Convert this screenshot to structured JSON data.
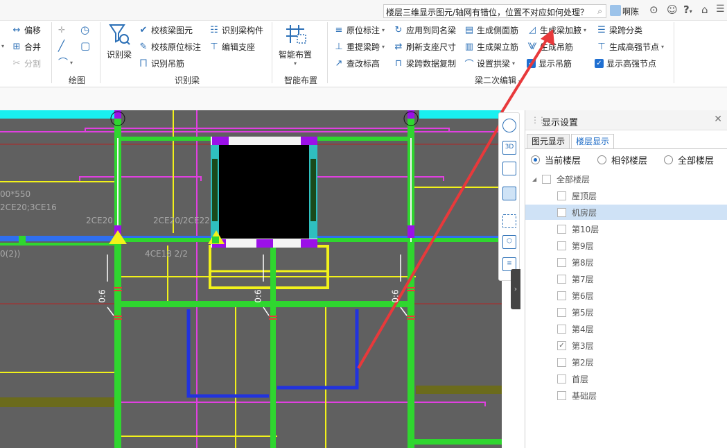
{
  "topbar": {
    "search_text": "楼层三维显示图元/轴网有错位，位置不对应如何处理？",
    "user_name": "啊陈",
    "help_label": "?"
  },
  "ribbon": {
    "edit": {
      "offset": "偏移",
      "merge": "合并",
      "split": "分割"
    },
    "draw": {
      "group_label": "绘图"
    },
    "identify": {
      "big_button": "识别梁",
      "check_beam": "校核梁图元",
      "check_original": "校核原位标注",
      "identify_hanger": "识别吊筋",
      "identify_component": "识别梁构件",
      "edit_support": "编辑支座",
      "group_label": "识别梁"
    },
    "smart": {
      "big_button": "智能布置",
      "group_label": "智能布置"
    },
    "secondary": {
      "original_annotation": "原位标注",
      "apply_same_name": "应用到同名梁",
      "gen_side_bar": "生成侧面筋",
      "gen_haunch": "生成梁加腋",
      "span_classify": "梁跨分类",
      "re_extract_span": "重提梁跨",
      "refresh_support": "刷新支座尺寸",
      "gen_stirrup": "生成架立筋",
      "gen_hanger": "生成吊筋",
      "gen_high_node": "生成高强节点",
      "check_elevation": "查改标高",
      "copy_span_data": "梁跨数据复制",
      "set_arch": "设置拱梁",
      "show_hanger": "显示吊筋",
      "show_high_node": "显示高强节点",
      "group_label": "梁二次编辑"
    }
  },
  "canvas": {
    "labels": {
      "size_text": "00*550",
      "bar_text": "2CE20;3CE16",
      "left_top": "2CE20",
      "top_mid": "2CE20/2CE22",
      "mid_bar": "4CE18 2/2",
      "left_paren": "0(2))",
      "dim_1": "0:6",
      "dim_2": "0:6",
      "dim_3": "0:6"
    },
    "colors": {
      "background": "#606060",
      "beam_green": "#2fd62f",
      "beam_yellow": "#f2f21a",
      "magenta": "#e040e0",
      "blue": "#2233dd",
      "cyan": "#19f0f0",
      "red_arrow": "#e8393b",
      "axis_red": "#b52424"
    }
  },
  "panel": {
    "title": "显示设置",
    "tabs": [
      "图元显示",
      "楼层显示"
    ],
    "active_tab": "楼层显示",
    "radios": [
      "当前楼层",
      "相邻楼层",
      "全部楼层"
    ],
    "selected_radio": "当前楼层",
    "tree_root": "全部楼层",
    "floors": [
      {
        "name": "屋顶层",
        "checked": false,
        "selected": false
      },
      {
        "name": "机房层",
        "checked": false,
        "selected": true
      },
      {
        "name": "第10层",
        "checked": false,
        "selected": false
      },
      {
        "name": "第9层",
        "checked": false,
        "selected": false
      },
      {
        "name": "第8层",
        "checked": false,
        "selected": false
      },
      {
        "name": "第7层",
        "checked": false,
        "selected": false
      },
      {
        "name": "第6层",
        "checked": false,
        "selected": false
      },
      {
        "name": "第5层",
        "checked": false,
        "selected": false
      },
      {
        "name": "第4层",
        "checked": false,
        "selected": false
      },
      {
        "name": "第3层",
        "checked": true,
        "selected": false
      },
      {
        "name": "第2层",
        "checked": false,
        "selected": false
      },
      {
        "name": "首层",
        "checked": false,
        "selected": false
      },
      {
        "name": "基础层",
        "checked": false,
        "selected": false
      }
    ]
  },
  "vtools": [
    "globe-view",
    "3d-view",
    "box-view",
    "layer-view",
    "select-view",
    "cube-view",
    "property-view"
  ]
}
